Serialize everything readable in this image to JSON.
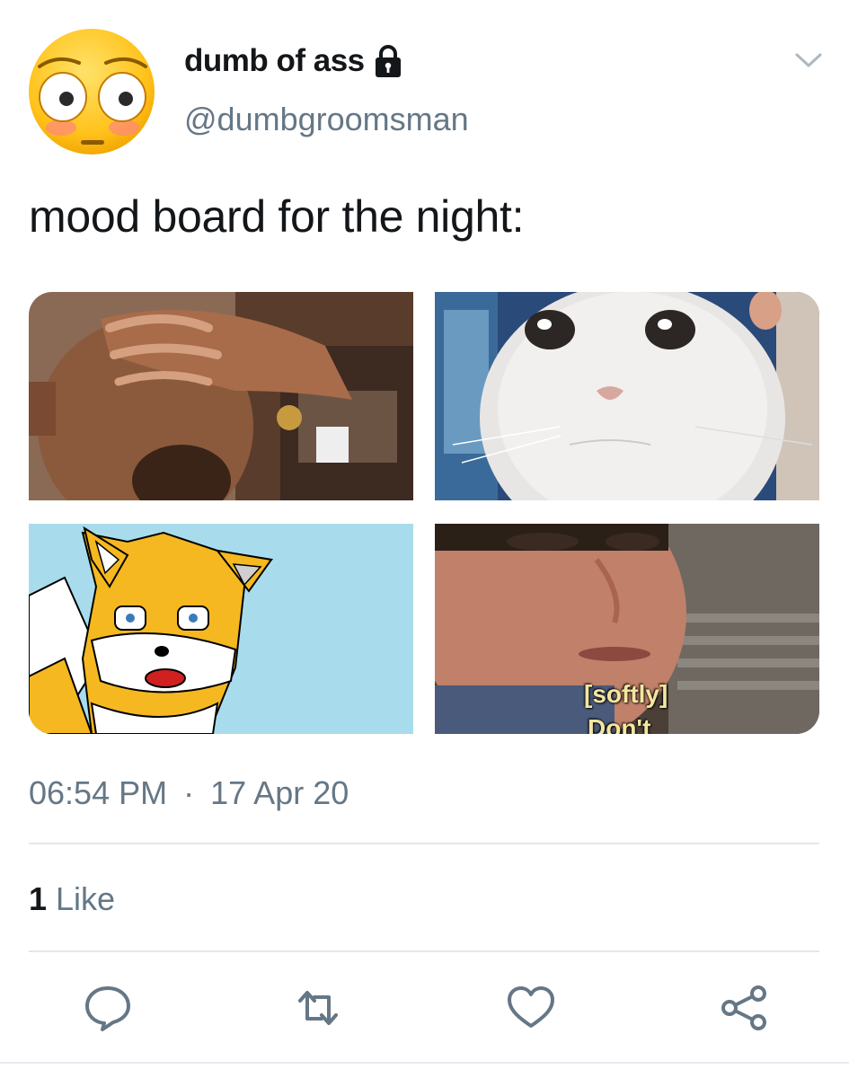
{
  "tweet": {
    "display_name": "dumb of ass",
    "handle": "@dumbgroomsman",
    "text": "mood board for the night:",
    "time": "06:54 PM",
    "separator": "·",
    "date": "17 Apr 20",
    "likes_count": "1",
    "likes_label": "Like",
    "protected_icon": "lock-icon",
    "avatar_icon": "flushed-face-emoji",
    "images": [
      {
        "name": "facepalm-photo"
      },
      {
        "name": "crying-cat-photo"
      },
      {
        "name": "cartoon-fox-drawing"
      },
      {
        "name": "man-closeup-photo",
        "subtitle_line1": "[softly]",
        "subtitle_line2": "Don't"
      }
    ]
  },
  "actions": [
    {
      "name": "reply-icon"
    },
    {
      "name": "retweet-icon"
    },
    {
      "name": "like-icon"
    },
    {
      "name": "share-icon"
    }
  ],
  "colors": {
    "primary_text": "#14171a",
    "secondary_text": "#657786",
    "divider": "#e1e8ed",
    "icon": "#657786"
  }
}
